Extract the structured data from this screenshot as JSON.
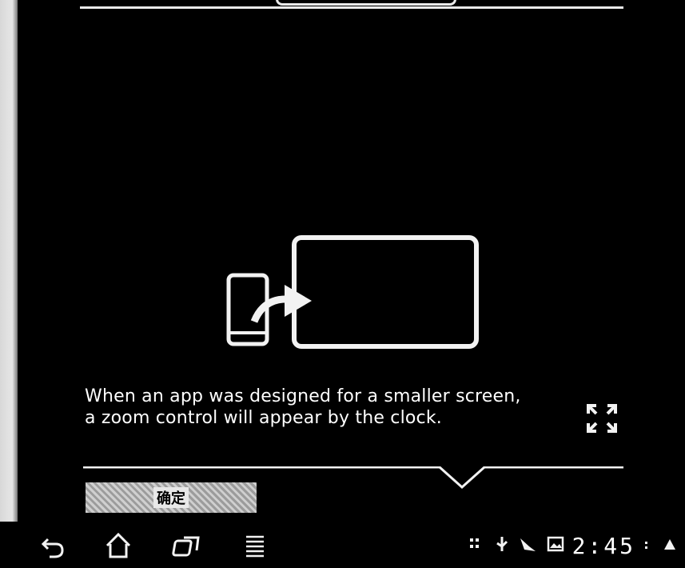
{
  "tooltip": {
    "message": "When an app was designed for a smaller screen, a zoom control will appear by the clock.",
    "ok_label": "确定"
  },
  "status_bar": {
    "clock": "2:45"
  },
  "icons": {
    "illustration": "phone-to-tablet-icon",
    "zoom": "zoom-expand-icon",
    "back": "back-icon",
    "home": "home-icon",
    "recent_apps": "recent-apps-icon",
    "menu": "menu-icon",
    "screenshot": "screenshot-icon",
    "usb": "usb-icon",
    "notifications": "notification-icon",
    "gallery": "gallery-icon",
    "wifi": "wifi-icon",
    "battery": "battery-icon"
  },
  "colors": {
    "background": "#000000",
    "foreground": "#ffffff"
  }
}
